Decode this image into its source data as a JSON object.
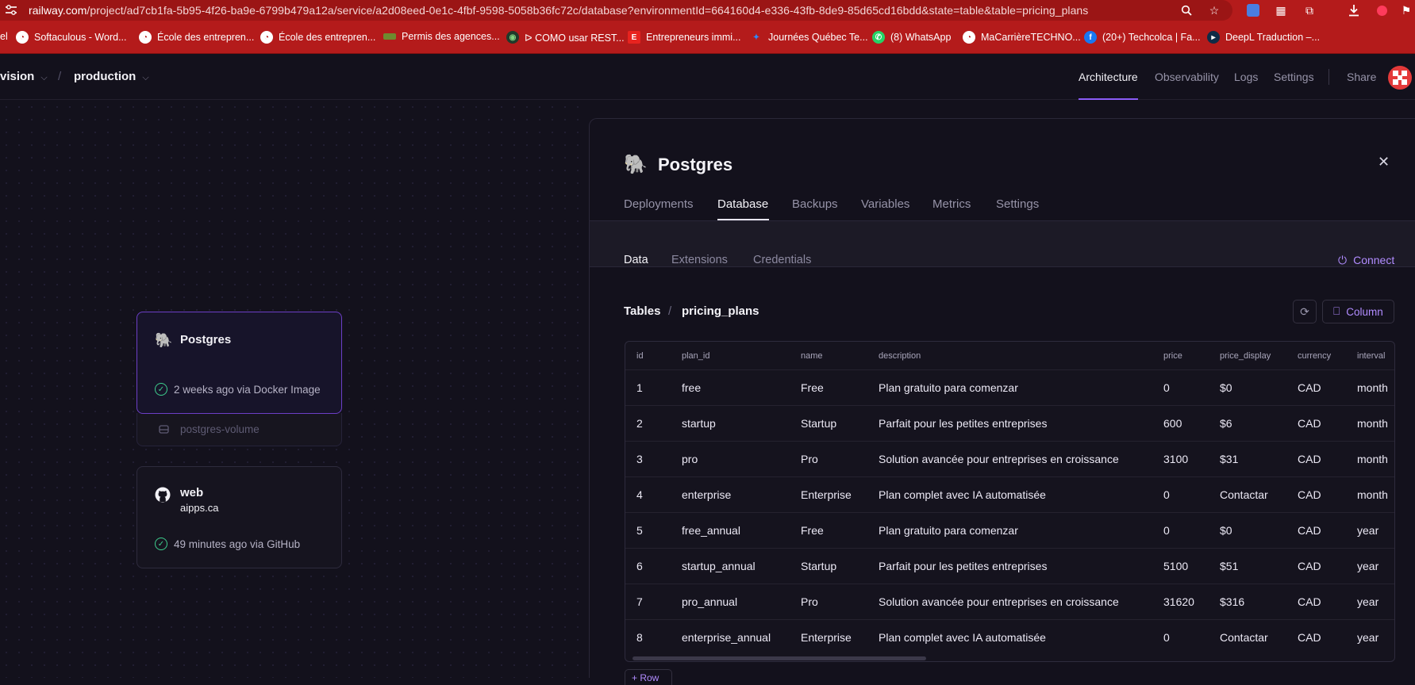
{
  "browser": {
    "url_host": "railway.com",
    "url_path": "/project/ad7cb1fa-5b95-4f26-ba9e-6799b479a12a/service/a2d08eed-0e1c-4fbf-9598-5058b36fc72c/database?environmentId=664160d4-e336-43fb-8de9-85d65cd16bdd&state=table&table=pricing_plans",
    "bookmarks": [
      {
        "label": "el",
        "icon": "bookmark-icon"
      },
      {
        "label": "Softaculous - Word...",
        "icon": "softaculous-icon"
      },
      {
        "label": "École des entrepren...",
        "icon": "softaculous-icon"
      },
      {
        "label": "École des entrepren...",
        "icon": "softaculous-icon"
      },
      {
        "label": "Permis des agences...",
        "icon": "bookmark-icon"
      },
      {
        "label": "ᐅ COMO usar REST...",
        "icon": "globe-icon"
      },
      {
        "label": "Entrepreneurs immi...",
        "icon": "e-icon"
      },
      {
        "label": "Journées Québec Te...",
        "icon": "star-logo-icon"
      },
      {
        "label": "(8) WhatsApp",
        "icon": "whatsapp-icon"
      },
      {
        "label": "MaCarrièreTECHNO...",
        "icon": "softaculous-icon"
      },
      {
        "label": "(20+) Techcolca | Fa...",
        "icon": "facebook-icon"
      },
      {
        "label": "DeepL Traduction –...",
        "icon": "deepl-icon"
      }
    ]
  },
  "header": {
    "project": "vision",
    "environment": "production",
    "nav": [
      "Architecture",
      "Observability",
      "Logs",
      "Settings"
    ],
    "share": "Share"
  },
  "canvas": {
    "postgres": {
      "title": "Postgres",
      "status": "2 weeks ago via Docker Image",
      "volume": "postgres-volume"
    },
    "web": {
      "title": "web",
      "domain": "aipps.ca",
      "status": "49 minutes ago via GitHub"
    }
  },
  "panel": {
    "title": "Postgres",
    "tabs": [
      "Deployments",
      "Database",
      "Backups",
      "Variables",
      "Metrics",
      "Settings"
    ],
    "subtabs": [
      "Data",
      "Extensions",
      "Credentials"
    ],
    "connect": "Connect",
    "crumb_root": "Tables",
    "crumb_table": "pricing_plans",
    "column_button": "Column",
    "row_button": "+ Row"
  },
  "table": {
    "columns": [
      "id",
      "plan_id",
      "name",
      "description",
      "price",
      "price_display",
      "currency",
      "interval"
    ],
    "rows": [
      [
        "1",
        "free",
        "Free",
        "Plan gratuito para comenzar",
        "0",
        "$0",
        "CAD",
        "month"
      ],
      [
        "2",
        "startup",
        "Startup",
        "Parfait pour les petites entreprises",
        "600",
        "$6",
        "CAD",
        "month"
      ],
      [
        "3",
        "pro",
        "Pro",
        "Solution avancée pour entreprises en croissance",
        "3100",
        "$31",
        "CAD",
        "month"
      ],
      [
        "4",
        "enterprise",
        "Enterprise",
        "Plan complet avec IA automatisée",
        "0",
        "Contactar",
        "CAD",
        "month"
      ],
      [
        "5",
        "free_annual",
        "Free",
        "Plan gratuito para comenzar",
        "0",
        "$0",
        "CAD",
        "year"
      ],
      [
        "6",
        "startup_annual",
        "Startup",
        "Parfait pour les petites entreprises",
        "5100",
        "$51",
        "CAD",
        "year"
      ],
      [
        "7",
        "pro_annual",
        "Pro",
        "Solution avancée pour entreprises en croissance",
        "31620",
        "$316",
        "CAD",
        "year"
      ],
      [
        "8",
        "enterprise_annual",
        "Enterprise",
        "Plan complet avec IA automatisée",
        "0",
        "Contactar",
        "CAD",
        "year"
      ]
    ]
  },
  "colors": {
    "accent": "#8a5cf6",
    "link": "#b18cff",
    "success": "#3ecf8e",
    "browser_chrome": "#b41b1b"
  }
}
